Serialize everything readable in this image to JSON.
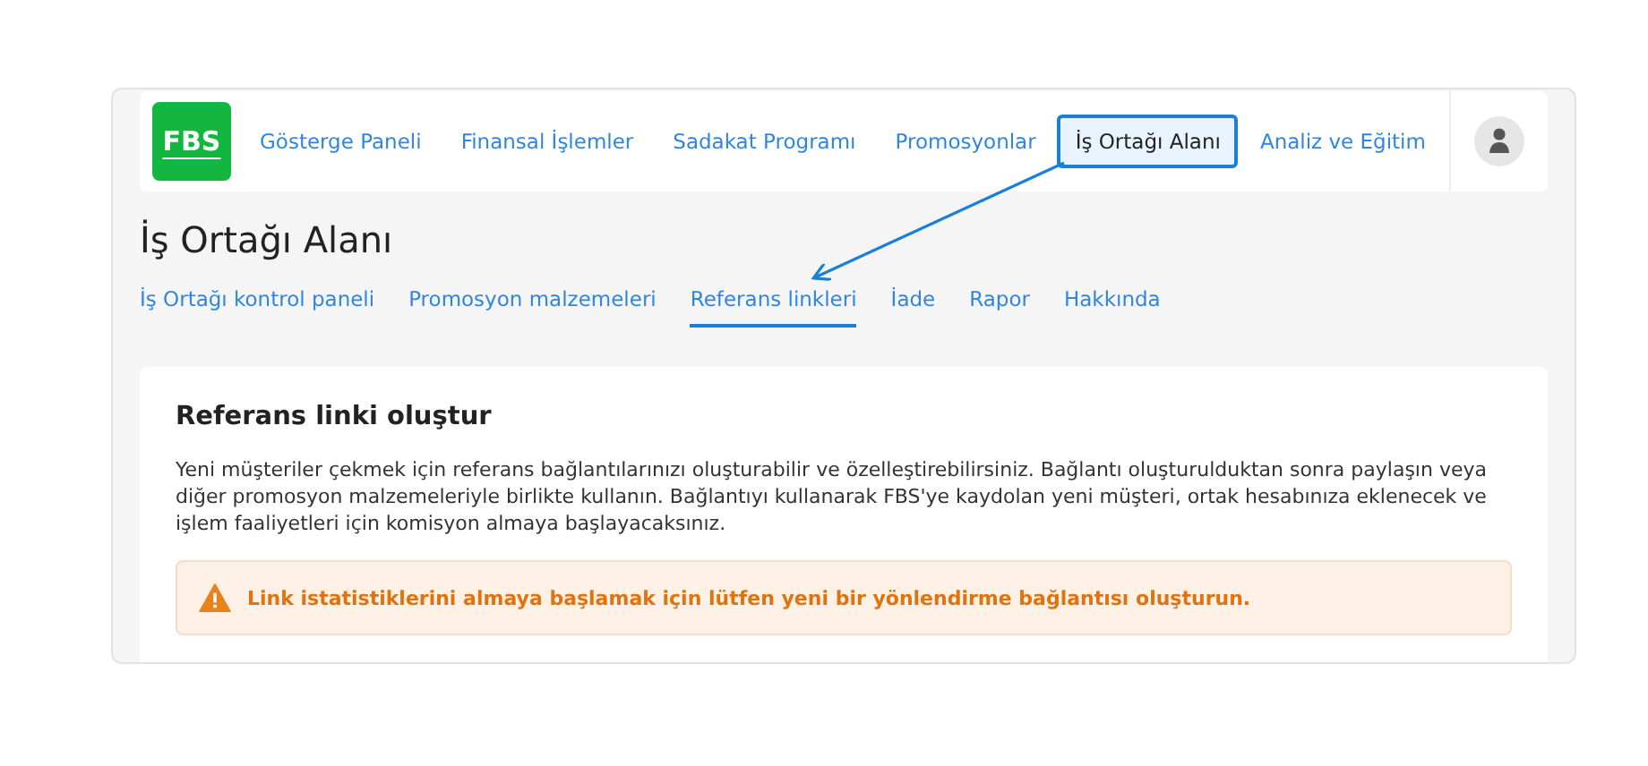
{
  "logo": "FBS",
  "nav": [
    {
      "label": "Gösterge Paneli",
      "selected": false
    },
    {
      "label": "Finansal İşlemler",
      "selected": false
    },
    {
      "label": "Sadakat Programı",
      "selected": false
    },
    {
      "label": "Promosyonlar",
      "selected": false
    },
    {
      "label": "İş Ortağı Alanı",
      "selected": true
    },
    {
      "label": "Analiz ve Eğitim",
      "selected": false
    }
  ],
  "page_title": "İş Ortağı Alanı",
  "tabs": [
    {
      "label": "İş Ortağı kontrol paneli",
      "selected": false
    },
    {
      "label": "Promosyon malzemeleri",
      "selected": false
    },
    {
      "label": "Referans linkleri",
      "selected": true
    },
    {
      "label": "İade",
      "selected": false
    },
    {
      "label": "Rapor",
      "selected": false
    },
    {
      "label": "Hakkında",
      "selected": false
    }
  ],
  "card": {
    "heading": "Referans linki oluştur",
    "text": "Yeni müşteriler çekmek için referans bağlantılarınızı oluşturabilir ve özelleştirebilirsiniz. Bağlantı oluşturulduktan sonra paylaşın veya diğer promosyon malzemeleriyle birlikte kullanın. Bağlantıyı kullanarak FBS'ye kaydolan yeni müşteri, ortak hesabınıza eklenecek ve işlem faaliyetleri için komisyon almaya başlayacaksınız.",
    "alert": "Link istatistiklerini almaya başlamak için lütfen yeni bir yönlendirme bağlantısı oluşturun."
  }
}
